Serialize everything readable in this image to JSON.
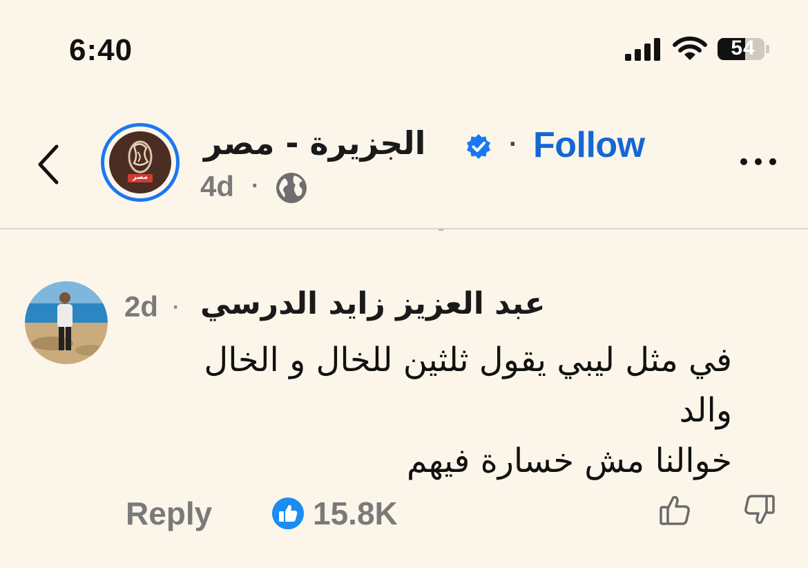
{
  "status_bar": {
    "time": "6:40",
    "battery_level": "54",
    "icons": [
      "signal-icon",
      "wifi-icon",
      "battery-icon"
    ]
  },
  "post_header": {
    "page_name": "الجزيرة  - مصر",
    "verified": true,
    "follow_label": "Follow",
    "separator": "·",
    "age": "4d",
    "audience_icon": "globe-icon",
    "avatar_badge": "مصر",
    "icons": [
      "back-chevron-icon",
      "verified-badge-icon",
      "more-dots-icon"
    ]
  },
  "comment": {
    "author": "عبد العزيز زايد الدرسي",
    "age": "2d",
    "separator": "·",
    "lines": [
      "في مثل ليبي يقول ثلثين للخال و الخال",
      "والد",
      "خوالنا مش خسارة فيهم"
    ],
    "reply_label": "Reply",
    "like_count": "15.8K",
    "icons": [
      "like-badge-icon",
      "thumbs-up-icon",
      "thumbs-down-icon"
    ]
  },
  "colors": {
    "background": "#fcf6ea",
    "accent": "#1467d4",
    "avatar_ring": "#1a78f2",
    "muted_text": "#7a7a7a"
  }
}
